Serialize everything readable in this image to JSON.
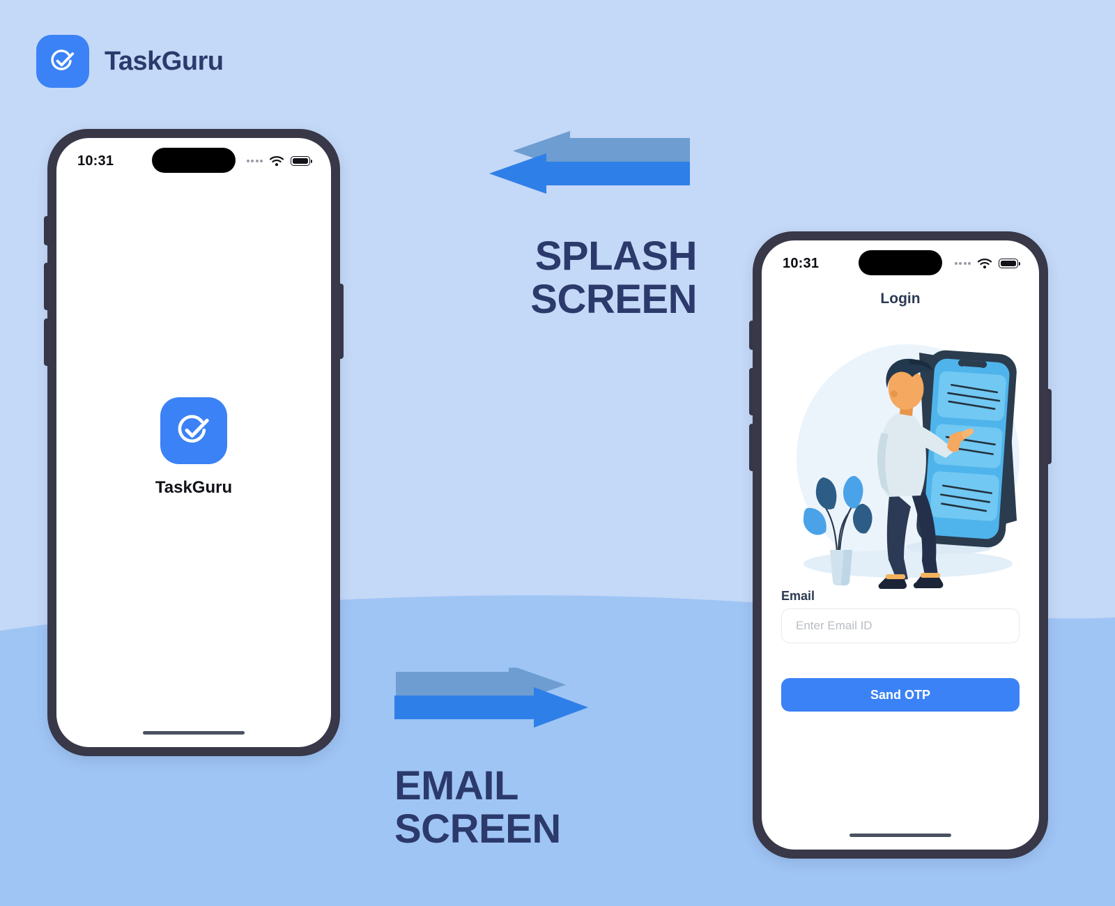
{
  "brand": {
    "name": "TaskGuru",
    "logo_icon": "check-circle-icon",
    "accent_color": "#3b82f6",
    "navy_color": "#2b3a6b"
  },
  "background": {
    "top_color": "#c4d8f7",
    "bottom_color": "#9fc5f5"
  },
  "splash_phone": {
    "statusbar": {
      "time": "10:31",
      "signal_icon": "signal-dots-icon",
      "wifi_icon": "wifi-icon",
      "battery_icon": "battery-icon"
    },
    "app_icon": "check-circle-icon",
    "app_name": "TaskGuru",
    "home_indicator": "home-indicator"
  },
  "login_phone": {
    "statusbar": {
      "time": "10:31",
      "signal_icon": "signal-dots-icon",
      "wifi_icon": "wifi-icon",
      "battery_icon": "battery-icon"
    },
    "title": "Login",
    "illustration": "person-using-phone-illustration",
    "email_label": "Email",
    "email_value": "",
    "email_placeholder": "Enter Email ID",
    "submit_label": "Sand OTP",
    "home_indicator": "home-indicator"
  },
  "annotations": [
    {
      "id": "splash",
      "line1": "SPLASH",
      "line2": "SCREEN",
      "direction": "left",
      "arrow_top_color": "#6d9dd1",
      "arrow_bottom_color": "#2f7fe8"
    },
    {
      "id": "email",
      "line1": "EMAIL",
      "line2": "SCREEN",
      "direction": "right",
      "arrow_top_color": "#6d9dd1",
      "arrow_bottom_color": "#2f7fe8"
    }
  ]
}
